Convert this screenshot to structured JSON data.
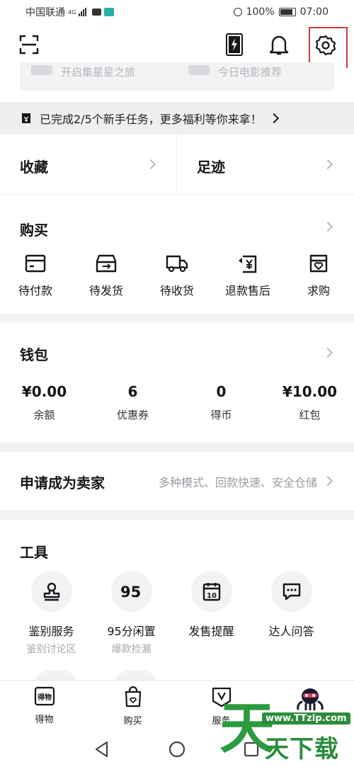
{
  "status_bar": {
    "carrier": "中国联通",
    "network": "4G",
    "battery": "100%",
    "time": "07:00"
  },
  "header": {
    "scan_icon": "scan-icon",
    "card_icon": "card-icon",
    "bell_icon": "bell-icon",
    "settings_icon": "gear-icon"
  },
  "banner_peek": {
    "left_text": "开启集星星之旅",
    "right_text": "今日电影推荐"
  },
  "task_bar": {
    "text": "已完成2/5个新手任务，更多福利等你来拿！"
  },
  "favorites": {
    "collect_label": "收藏",
    "footprint_label": "足迹"
  },
  "buy": {
    "title": "购买",
    "items": [
      {
        "label": "待付款",
        "icon": "wallet-icon"
      },
      {
        "label": "待发货",
        "icon": "box-icon"
      },
      {
        "label": "待收货",
        "icon": "truck-icon"
      },
      {
        "label": "退款售后",
        "icon": "refund-icon"
      },
      {
        "label": "求购",
        "icon": "bag-icon"
      }
    ]
  },
  "wallet": {
    "title": "钱包",
    "items": [
      {
        "value": "¥0.00",
        "label": "余额"
      },
      {
        "value": "6",
        "label": "优惠券"
      },
      {
        "value": "0",
        "label": "得币"
      },
      {
        "value": "¥10.00",
        "label": "红包"
      }
    ]
  },
  "seller": {
    "title": "申请成为卖家",
    "hint": "多种模式、回款快速、安全仓储"
  },
  "tools": {
    "title": "工具",
    "items": [
      {
        "label": "鉴别服务",
        "sub": "鉴别讨论区",
        "icon": "stamp-icon"
      },
      {
        "label": "95分闲置",
        "sub": "爆款捡漏",
        "icon": "95-icon"
      },
      {
        "label": "发售提醒",
        "sub": "",
        "icon": "calendar-icon"
      },
      {
        "label": "达人问答",
        "sub": "",
        "icon": "chat-icon"
      }
    ]
  },
  "tabbar": {
    "items": [
      {
        "label": "得物",
        "icon": "dewu-icon"
      },
      {
        "label": "购买",
        "icon": "shopping-bag-icon"
      },
      {
        "label": "服务",
        "icon": "service-icon"
      },
      {
        "label": "",
        "icon": "avatar-icon"
      }
    ]
  },
  "watermark": {
    "url": "www.TTzip.com",
    "text": "天下载",
    "big_char": "天"
  },
  "colors": {
    "highlight": "#d23a3a",
    "watermark": "#2b8c3b"
  }
}
